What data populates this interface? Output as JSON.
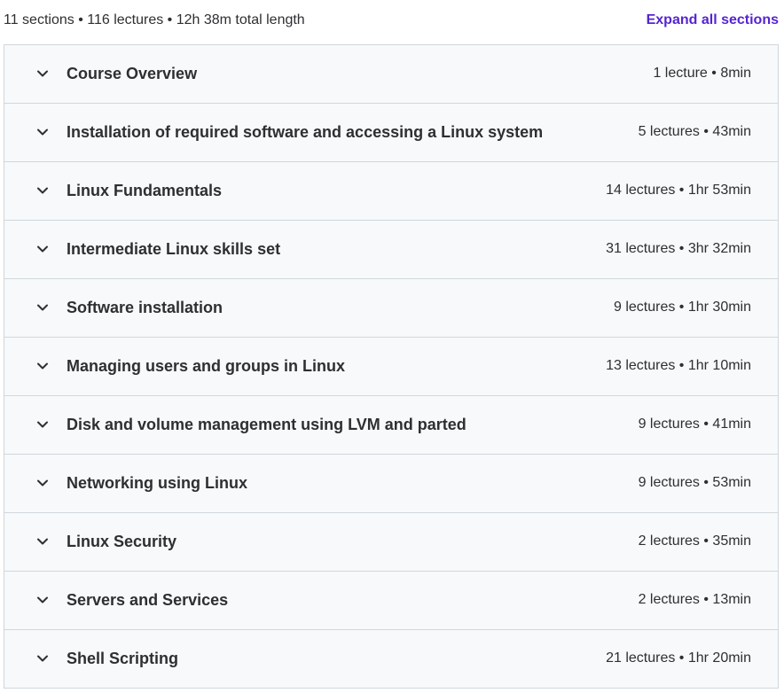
{
  "curriculum": {
    "summary": "11 sections • 116 lectures • 12h 38m total length",
    "expand_all_label": "Expand all sections",
    "accent_color": "#5624d0",
    "chevron_icon": "chevron-down-icon",
    "sections": [
      {
        "title": "Course Overview",
        "meta": "1 lecture • 8min"
      },
      {
        "title": "Installation of required software and accessing a Linux system",
        "meta": "5 lectures • 43min"
      },
      {
        "title": "Linux Fundamentals",
        "meta": "14 lectures • 1hr 53min"
      },
      {
        "title": "Intermediate Linux skills set",
        "meta": "31 lectures • 3hr 32min"
      },
      {
        "title": "Software installation",
        "meta": "9 lectures • 1hr 30min"
      },
      {
        "title": "Managing users and groups in Linux",
        "meta": "13 lectures • 1hr 10min"
      },
      {
        "title": "Disk and volume management using LVM and parted",
        "meta": "9 lectures • 41min"
      },
      {
        "title": "Networking using Linux",
        "meta": "9 lectures • 53min"
      },
      {
        "title": "Linux Security",
        "meta": "2 lectures • 35min"
      },
      {
        "title": "Servers and Services",
        "meta": "2 lectures • 13min"
      },
      {
        "title": "Shell Scripting",
        "meta": "21 lectures • 1hr 20min"
      }
    ]
  }
}
